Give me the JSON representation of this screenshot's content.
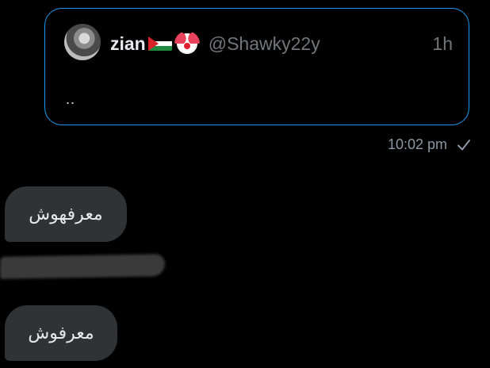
{
  "quoted_tweet": {
    "display_name": "zian",
    "flag_emoji": "palestine-flag-icon",
    "emoji": "clown-face-icon",
    "handle": "@Shawky22y",
    "time_ago": "1h",
    "text": ".."
  },
  "sent_meta": {
    "timestamp": "10:02 pm",
    "status_icon": "check-icon"
  },
  "messages": [
    {
      "text": "معرفهوش"
    },
    {
      "text": "معرفوش"
    }
  ],
  "colors": {
    "background": "#000000",
    "card_border": "#1d9bf0",
    "bubble": "#2f3336",
    "muted_text": "#71767b"
  }
}
